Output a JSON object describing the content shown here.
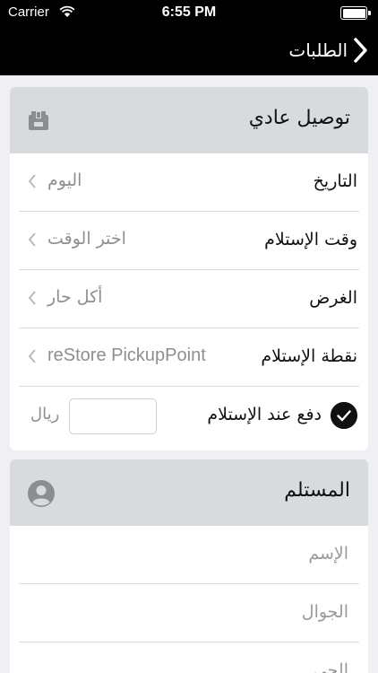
{
  "status_bar": {
    "carrier": "Carrier",
    "time": "6:55 PM"
  },
  "nav": {
    "back_label": "الطلبات"
  },
  "delivery_card": {
    "title": "توصيل عادي",
    "header_icon": "package-icon",
    "rows": [
      {
        "label": "التاريخ",
        "value": "اليوم"
      },
      {
        "label": "وقت الإستلام",
        "value": "اختر الوقت"
      },
      {
        "label": "الغرض",
        "value": "أكل حار"
      },
      {
        "label": "نقطة الإستلام",
        "value": "reStore PickupPoint"
      }
    ],
    "cod": {
      "label": "دفع عند الإستلام",
      "checked": true,
      "currency": "ريال",
      "amount": ""
    }
  },
  "recipient_card": {
    "title": "المستلم",
    "header_icon": "person-icon",
    "fields": [
      {
        "placeholder": "الإسم"
      },
      {
        "placeholder": "الجوال"
      },
      {
        "placeholder": "الحي"
      }
    ]
  }
}
